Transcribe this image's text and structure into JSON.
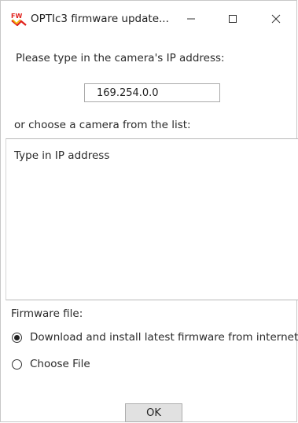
{
  "window": {
    "title": "OPTIc3 firmware update...",
    "icon": "fw-app-icon",
    "controls": {
      "minimize_icon": "minimize-icon",
      "maximize_icon": "maximize-icon",
      "close_icon": "close-icon"
    }
  },
  "ip_section": {
    "prompt": "Please type in the camera's IP address:",
    "ip_value": "169.254.0.0"
  },
  "list_section": {
    "prompt": "or choose a camera from the list:",
    "items": [
      "Type in IP address"
    ]
  },
  "firmware": {
    "label": "Firmware file:",
    "options": [
      {
        "label": "Download and install latest firmware from internet",
        "selected": true
      },
      {
        "label": "Choose File",
        "selected": false
      }
    ]
  },
  "actions": {
    "ok_label": "OK"
  },
  "colors": {
    "icon_red": "#e0201b",
    "icon_yellow": "#f2b800",
    "button_bg": "#e1e1e1"
  }
}
